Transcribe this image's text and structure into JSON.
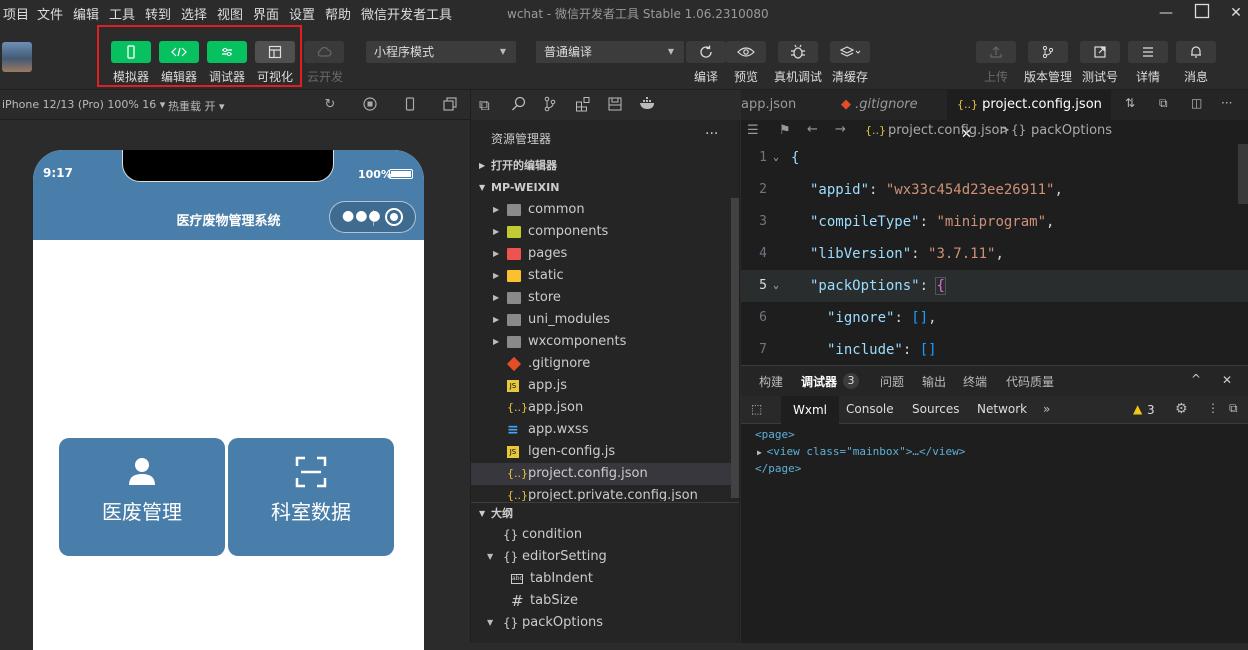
{
  "menu": [
    "项目",
    "文件",
    "编辑",
    "工具",
    "转到",
    "选择",
    "视图",
    "界面",
    "设置",
    "帮助",
    "微信开发者工具"
  ],
  "window_title": "wchat - 微信开发者工具 Stable 1.06.2310080",
  "toolbar": {
    "simulator": "模拟器",
    "editor": "编辑器",
    "debugger": "调试器",
    "visual": "可视化",
    "cloud": "云开发",
    "mode_select": "小程序模式",
    "compile_select": "普通编译",
    "compile": "编译",
    "preview": "预览",
    "remote_debug": "真机调试",
    "clear_cache": "清缓存",
    "upload": "上传",
    "version": "版本管理",
    "test_account": "测试号",
    "details": "详情",
    "messages": "消息"
  },
  "simbar": {
    "device": "iPhone 12/13 (Pro) 100% 16 ▾",
    "hot_reload": "热重载 开 ▾"
  },
  "phone": {
    "time": "9:17",
    "battery": "100%",
    "page_title": "医疗废物管理系统",
    "card1": "医废管理",
    "card2": "科室数据"
  },
  "explorer": {
    "title": "资源管理器",
    "open_editors": "打开的编辑器",
    "project": "MP-WEIXIN",
    "files": [
      {
        "name": "common",
        "type": "folder"
      },
      {
        "name": "components",
        "type": "folder"
      },
      {
        "name": "pages",
        "type": "folder"
      },
      {
        "name": "static",
        "type": "folder"
      },
      {
        "name": "store",
        "type": "folder"
      },
      {
        "name": "uni_modules",
        "type": "folder"
      },
      {
        "name": "wxcomponents",
        "type": "folder"
      },
      {
        "name": ".gitignore",
        "type": "git"
      },
      {
        "name": "app.js",
        "type": "js"
      },
      {
        "name": "app.json",
        "type": "json"
      },
      {
        "name": "app.wxss",
        "type": "css"
      },
      {
        "name": "lgen-config.js",
        "type": "js"
      },
      {
        "name": "project.config.json",
        "type": "json"
      },
      {
        "name": "project.private.config.json",
        "type": "json"
      }
    ],
    "outline_title": "大纲",
    "outline": [
      "condition",
      "editorSetting",
      "tabIndent",
      "tabSize",
      "packOptions"
    ]
  },
  "editor": {
    "tabs": [
      "app.json",
      ".gitignore",
      "project.config.json"
    ],
    "breadcrumb_file": "project.config.json",
    "breadcrumb_sep": ">",
    "breadcrumb_symbol": "packOptions",
    "lines": [
      {
        "n": "1",
        "text": "{"
      },
      {
        "n": "2",
        "key": "\"appid\"",
        "val": "\"wx33c454d23ee26911\""
      },
      {
        "n": "3",
        "key": "\"compileType\"",
        "val": "\"miniprogram\""
      },
      {
        "n": "4",
        "key": "\"libVersion\"",
        "val": "\"3.7.11\""
      },
      {
        "n": "5",
        "key": "\"packOptions\"",
        "val": "{"
      },
      {
        "n": "6",
        "key": "\"ignore\"",
        "val": "[]"
      },
      {
        "n": "7",
        "key": "\"include\"",
        "val": "[]"
      }
    ]
  },
  "debugger": {
    "tabs": [
      "构建",
      "调试器",
      "问题",
      "输出",
      "终端",
      "代码质量"
    ],
    "badge": "3",
    "subtabs": [
      "Wxml",
      "Console",
      "Sources",
      "Network"
    ],
    "warnings": "3",
    "wxml": [
      "<page>",
      "<view class=\"mainbox\">…</view>",
      "</page>"
    ]
  },
  "colors": {
    "accent_green": "#07c160",
    "phone_blue": "#4a7eaa",
    "highlight_red": "#e02020"
  }
}
